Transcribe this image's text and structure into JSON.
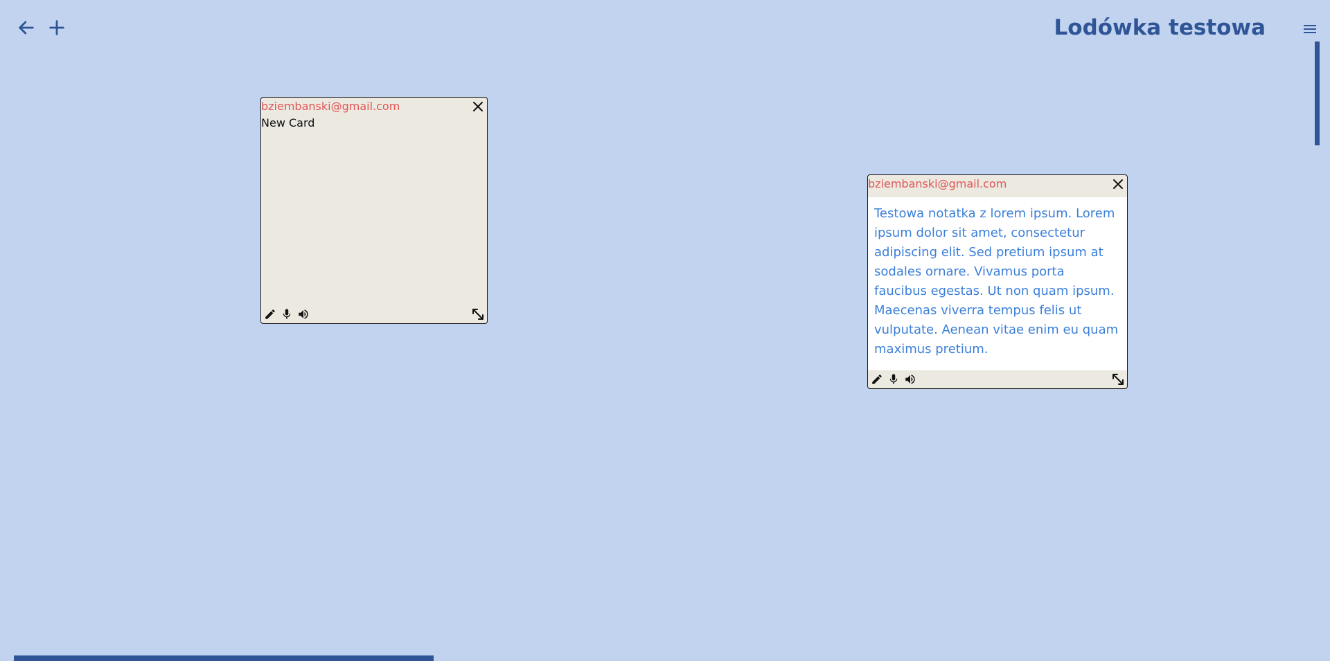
{
  "header": {
    "back_icon": "arrow-left-icon",
    "add_icon": "plus-icon",
    "title": "Lodówka testowa",
    "menu_icon": "hamburger-menu-icon"
  },
  "colors": {
    "background": "#c2d3f0",
    "accent": "#2f5597",
    "card_background": "#ece9e1",
    "owner_text": "#e05555",
    "note_text": "#3b7fd9"
  },
  "cards": [
    {
      "owner": "bziembanski@gmail.com",
      "title": "New Card",
      "tools": [
        "pencil-icon",
        "microphone-icon",
        "speaker-icon"
      ],
      "resize_icon": "resize-diagonal-icon",
      "close_icon": "close-icon"
    },
    {
      "owner": "bziembanski@gmail.com",
      "text": "Testowa notatka z lorem ipsum. Lorem ipsum dolor sit amet, consectetur adipiscing elit. Sed pretium ipsum at sodales ornare. Vivamus porta faucibus egestas. Ut non quam ipsum. Maecenas viverra tempus felis ut vulputate. Aenean vitae enim eu quam maximus pretium.",
      "tools": [
        "pencil-icon",
        "microphone-icon",
        "speaker-icon"
      ],
      "resize_icon": "resize-diagonal-icon",
      "close_icon": "close-icon"
    }
  ]
}
